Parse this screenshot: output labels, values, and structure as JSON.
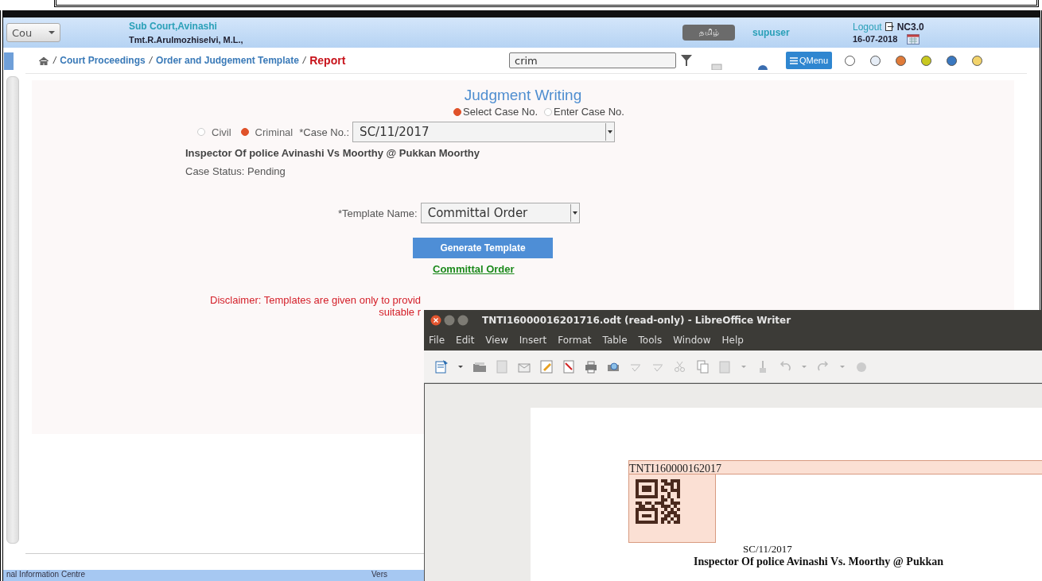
{
  "top_bar": {
    "court_dropdown": "Cou",
    "court_name": "Sub Court,Avinashi",
    "officer": "Tmt.R.Arulmozhiselvi, M.L.,",
    "language_button": "தமிழ்",
    "user": "supuser",
    "logout": "Logout",
    "version": "NC3.0",
    "date": "16-07-2018"
  },
  "breadcrumb": [
    {
      "separator": "/",
      "label": "Court Proceedings",
      "current": false
    },
    {
      "separator": "/",
      "label": "Order and Judgement Template",
      "current": false
    },
    {
      "separator": "/",
      "label": "Report",
      "current": true
    }
  ],
  "search": {
    "value": "crim"
  },
  "qmenu": {
    "label": "QMenu"
  },
  "themes": [
    {
      "color": "#ffffff"
    },
    {
      "color": "#e6edf6"
    },
    {
      "color": "#e07b39"
    },
    {
      "color": "#c8c820"
    },
    {
      "color": "#3a78c0"
    },
    {
      "color": "#f2d36b"
    }
  ],
  "form": {
    "title": "Judgment Writing",
    "case_mode": [
      {
        "label": "Select Case No.",
        "selected": true
      },
      {
        "label": "Enter Case No.",
        "selected": false
      }
    ],
    "case_type": [
      {
        "label": "Civil",
        "selected": false
      },
      {
        "label": "Criminal",
        "selected": true
      }
    ],
    "case_no_label": "*Case No.:",
    "case_no": "SC/11/2017",
    "parties": "Inspector Of police Avinashi Vs Moorthy @ Pukkan Moorthy",
    "status": "Case Status: Pending",
    "template_label": "*Template Name:",
    "template": "Committal Order",
    "generate_button": "Generate Template",
    "result_link": "Committal Order",
    "disclaimer_lines": [
      "Disclaimer: Templates are given only to provid",
      "suitable r"
    ]
  },
  "footer": {
    "left": "nal Information Centre",
    "right": "Vers"
  },
  "writer": {
    "title": "TNTI16000016201716.odt (read-only) - LibreOffice Writer",
    "menu": [
      "File",
      "Edit",
      "View",
      "Insert",
      "Format",
      "Table",
      "Tools",
      "Window",
      "Help"
    ],
    "document": {
      "header_code": "TNTI160000162017",
      "case_no": "SC/11/2017",
      "parties": "Inspector Of police Avinashi Vs. Moorthy @ Pukkan"
    }
  }
}
